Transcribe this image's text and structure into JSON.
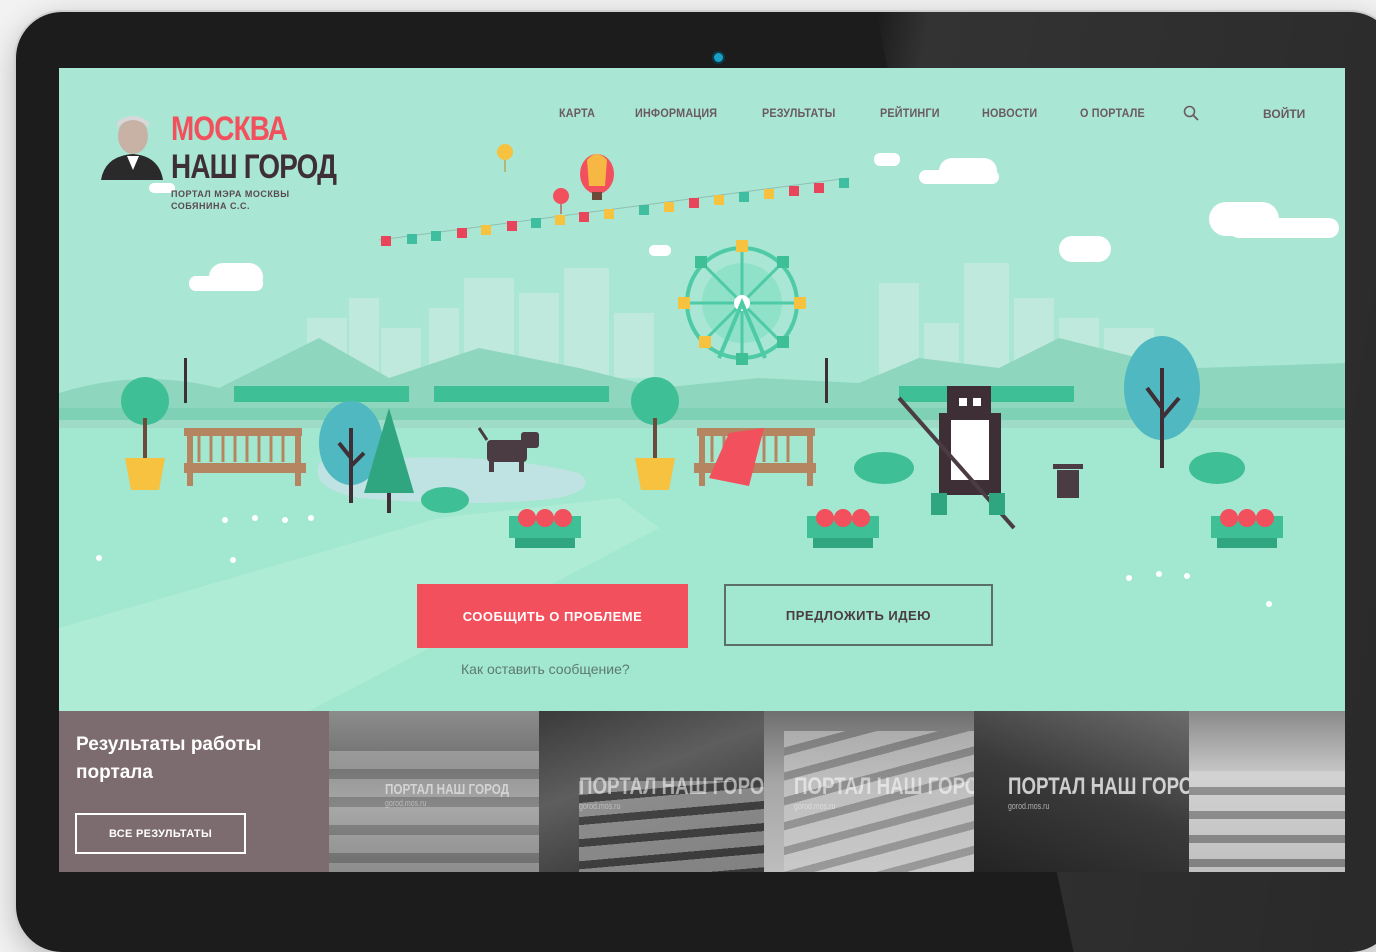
{
  "site": {
    "logo_line1": "МОСКВА",
    "logo_line2": "НАШ ГОРОД",
    "logo_sub": "ПОРТАЛ МЭРА МОСКВЫ СОБЯНИНА С.С."
  },
  "nav": {
    "items": [
      "КАРТА",
      "ИНФОРМАЦИЯ",
      "РЕЗУЛЬТАТЫ",
      "РЕЙТИНГИ",
      "НОВОСТИ",
      "О ПОРТАЛЕ"
    ],
    "login": "ВОЙТИ",
    "search_icon": "search-icon"
  },
  "hero": {
    "report_button": "СООБЩИТЬ О ПРОБЛЕМЕ",
    "idea_button": "ПРЕДЛОЖИТЬ ИДЕЮ",
    "howto_link": "Как оставить сообщение?"
  },
  "results": {
    "title": "Результаты работы портала",
    "all_button": "ВСЕ РЕЗУЛЬТАТЫ",
    "watermark": "ПОРТАЛ НАШ ГОРОД",
    "watermark_url": "gorod.mos.ru"
  },
  "colors": {
    "accent": "#f2505c",
    "hero_bg": "#a9e6d3",
    "dark": "#3e2f36"
  }
}
